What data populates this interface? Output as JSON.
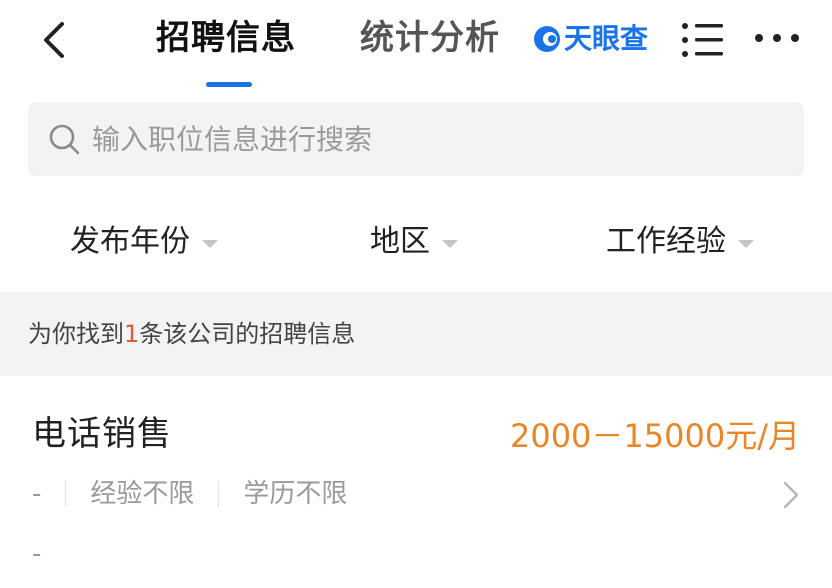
{
  "header": {
    "tabs": [
      {
        "label": "招聘信息",
        "active": true
      },
      {
        "label": "统计分析",
        "active": false
      }
    ],
    "logo_text": "天眼查",
    "accent_color": "#1a73e8",
    "icons": {
      "back": "chevron-left-icon",
      "menu": "list-menu-icon",
      "more": "more-dots-icon"
    }
  },
  "search": {
    "placeholder": "输入职位信息进行搜索",
    "value": ""
  },
  "filters": [
    {
      "label": "发布年份"
    },
    {
      "label": "地区"
    },
    {
      "label": "工作经验"
    }
  ],
  "summary": {
    "prefix": "为你找到",
    "count": "1",
    "suffix": "条该公司的招聘信息"
  },
  "jobs": [
    {
      "title": "电话销售",
      "salary": "2000－15000元/月",
      "location": "-",
      "experience": "经验不限",
      "education": "学历不限",
      "date": "-"
    }
  ],
  "colors": {
    "salary": "#e8862a",
    "count_highlight": "#e8563a",
    "summary_bg": "#f2f3f5"
  }
}
